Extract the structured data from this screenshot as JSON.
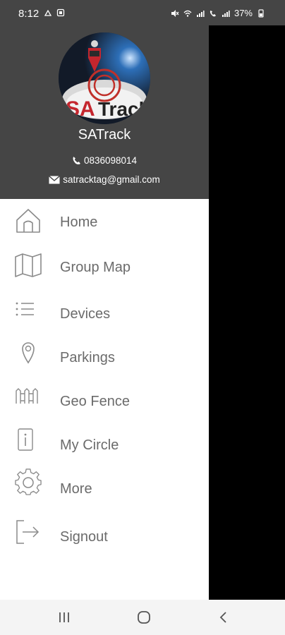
{
  "status_bar": {
    "time": "8:12",
    "battery": "37%"
  },
  "header": {
    "title": "SATrack",
    "phone": "0836098014",
    "email": "satracktag@gmail.com",
    "avatar_logo_text": "SATrack"
  },
  "menu": {
    "items": [
      {
        "label": "Home",
        "icon": "home-icon"
      },
      {
        "label": "Group Map",
        "icon": "map-icon"
      },
      {
        "label": "Devices",
        "icon": "list-icon"
      },
      {
        "label": "Parkings",
        "icon": "location-pin-icon"
      },
      {
        "label": "Geo Fence",
        "icon": "fence-icon"
      },
      {
        "label": "My Circle",
        "icon": "info-icon"
      },
      {
        "label": "More",
        "icon": "gear-icon"
      },
      {
        "label": "Signout",
        "icon": "signout-icon"
      }
    ]
  },
  "colors": {
    "header_bg": "#454545",
    "menu_text": "#6b6b6b",
    "icon_stroke": "#8a8a8a",
    "scrim": "#000000"
  }
}
